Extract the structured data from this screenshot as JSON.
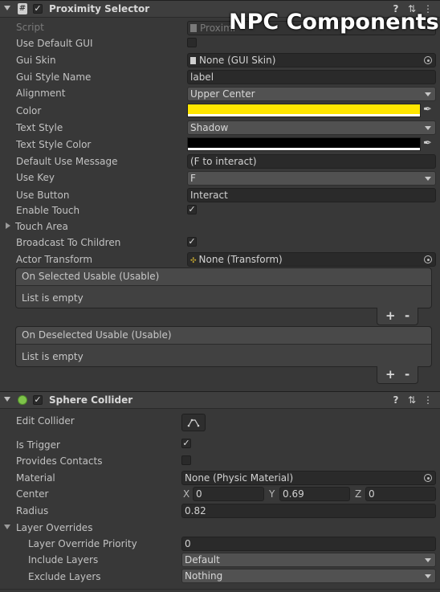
{
  "overlay_title": "NPC Components",
  "proximity": {
    "title": "Proximity Selector",
    "rows": {
      "script": {
        "label": "Script",
        "value": "Proximi"
      },
      "use_default_gui": {
        "label": "Use Default GUI"
      },
      "gui_skin": {
        "label": "Gui Skin",
        "value": "None (GUI Skin)"
      },
      "gui_style_name": {
        "label": "Gui Style Name",
        "value": "label"
      },
      "alignment": {
        "label": "Alignment",
        "value": "Upper Center"
      },
      "color": {
        "label": "Color",
        "value": "#ffe600"
      },
      "text_style": {
        "label": "Text Style",
        "value": "Shadow"
      },
      "text_style_color": {
        "label": "Text Style Color",
        "value": "#000000"
      },
      "default_use_message": {
        "label": "Default Use Message",
        "value": "(F to interact)"
      },
      "use_key": {
        "label": "Use Key",
        "value": "F"
      },
      "use_button": {
        "label": "Use Button",
        "value": "Interact"
      },
      "enable_touch": {
        "label": "Enable Touch"
      },
      "touch_area": {
        "label": "Touch Area"
      },
      "broadcast_to_children": {
        "label": "Broadcast To Children"
      },
      "actor_transform": {
        "label": "Actor Transform",
        "value": "None (Transform)"
      }
    },
    "events": [
      {
        "title": "On Selected Usable (Usable)",
        "body": "List is empty"
      },
      {
        "title": "On Deselected Usable (Usable)",
        "body": "List is empty"
      }
    ],
    "plus": "+",
    "minus": "-"
  },
  "sphere": {
    "title": "Sphere Collider",
    "rows": {
      "edit_collider": {
        "label": "Edit Collider"
      },
      "is_trigger": {
        "label": "Is Trigger"
      },
      "provides_contacts": {
        "label": "Provides Contacts"
      },
      "material": {
        "label": "Material",
        "value": "None (Physic Material)"
      },
      "center": {
        "label": "Center",
        "x_axis": "X",
        "x": "0",
        "y_axis": "Y",
        "y": "0.69",
        "z_axis": "Z",
        "z": "0"
      },
      "radius": {
        "label": "Radius",
        "value": "0.82"
      },
      "layer_overrides": {
        "label": "Layer Overrides"
      },
      "layer_override_priority": {
        "label": "Layer Override Priority",
        "value": "0"
      },
      "include_layers": {
        "label": "Include Layers",
        "value": "Default"
      },
      "exclude_layers": {
        "label": "Exclude Layers",
        "value": "Nothing"
      }
    }
  },
  "header_icons": {
    "help": "?",
    "settings": "⇅",
    "menu": "⋮"
  }
}
